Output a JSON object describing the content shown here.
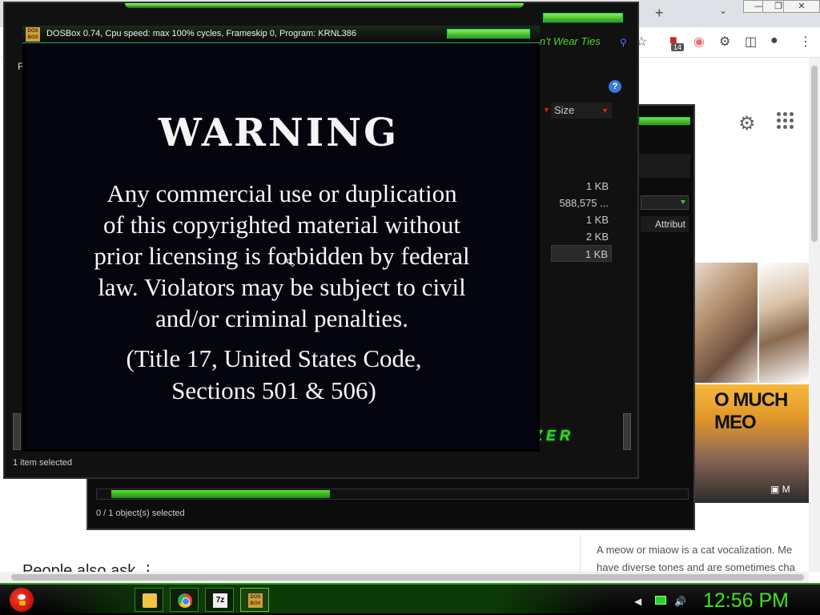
{
  "dosbox": {
    "title": "DOSBox 0.74, Cpu speed:  max 100% cycles, Frameskip  0, Program:  KRNL386",
    "icon_text": "DOS BOX",
    "warning_heading": "WARNING",
    "warning_body_lines": [
      "Any commercial use or duplication",
      "of this copyrighted material without",
      "prior licensing is forbidden by federal",
      "law. Violators may be subject to civil",
      "and/or criminal penalties."
    ],
    "citation_lines": [
      "(Title 17, United States Code,",
      "Sections 501 & 506)"
    ]
  },
  "explorer_main": {
    "address_text": "n't Wear Ties",
    "menu_file": "Fi",
    "column_size_header": "Size",
    "file_sizes": [
      "1 KB",
      "588,575 ...",
      "1 KB",
      "2 KB",
      "1 KB"
    ],
    "selected_row_index": 4,
    "status": "1 item selected",
    "brand_logo_text": "RAZER"
  },
  "explorer_back": {
    "attributes_header": "Attribut",
    "status": "0 / 1 object(s) selected",
    "progress_fraction": 0.39
  },
  "browser": {
    "new_tab_icon": "+",
    "extension_badge": "14",
    "people_also_ask": "People also ask",
    "knowledge_snippet_lines": [
      "A meow or miaow is a cat vocalization. Me",
      "have diverse tones and are sometimes cha"
    ],
    "thumbnail_text": "O MUCH MEO",
    "thumbnail_button": "M"
  },
  "taskbar": {
    "clock": "12:56 PM",
    "items": [
      {
        "name": "file-explorer",
        "label": ""
      },
      {
        "name": "chrome",
        "label": ""
      },
      {
        "name": "7zip",
        "label": "7z"
      },
      {
        "name": "dosbox",
        "label": "DOS BOX",
        "active": true
      }
    ]
  },
  "colors": {
    "accent_green": "#3fe51c",
    "dos_background": "#050510",
    "warning_text": "#f8f8f8"
  }
}
